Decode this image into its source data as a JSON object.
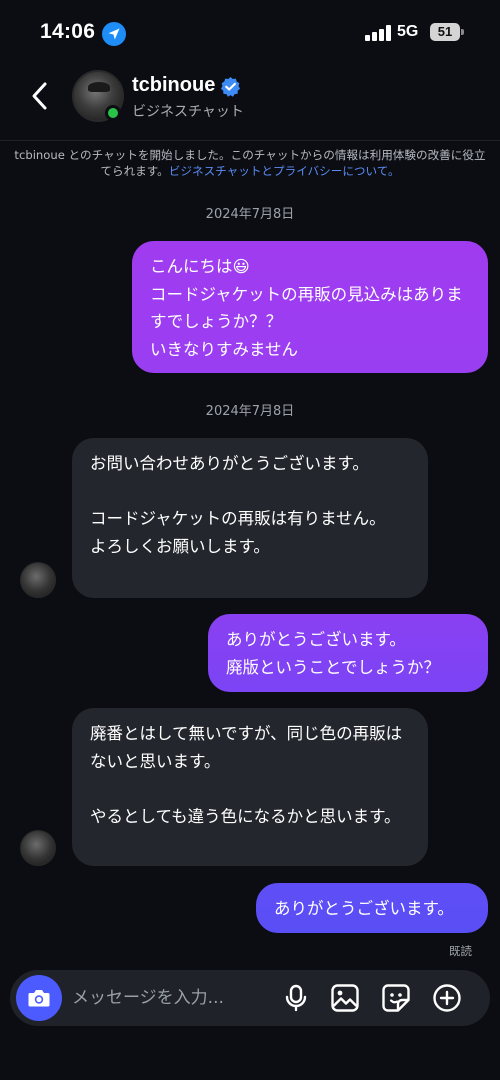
{
  "status_bar": {
    "time": "14:06",
    "network": "5G",
    "battery": "51",
    "location_icon": "location-arrow-icon",
    "signal_icon": "cellular-signal-icon"
  },
  "header": {
    "back_icon": "chevron-left-icon",
    "contact_name": "tcbinoue",
    "contact_subtitle": "ビジネスチャット",
    "verified_icon": "verified-badge-icon",
    "online": true
  },
  "notice": {
    "text": "tcbinoue とのチャットを開始しました。このチャットからの情報は利用体験の改善に役立てられます。",
    "link": "ビジネスチャットとプライバシーについて。"
  },
  "messages": [
    {
      "type": "date",
      "text": "2024年7月8日"
    },
    {
      "type": "outgoing",
      "text": "こんにちは😃\nコードジャケットの再販の見込みはありますでしょうか？？\nいきなりすみません"
    },
    {
      "type": "date",
      "text": "2024年7月8日"
    },
    {
      "type": "incoming",
      "text": "お問い合わせありがとうございます。\n\nコードジャケットの再販は有りません。\nよろしくお願いします。"
    },
    {
      "type": "outgoing",
      "text": "ありがとうございます。\n廃版ということでしょうか？"
    },
    {
      "type": "incoming",
      "text": "廃番とはして無いですが、同じ色の再販はないと思います。\n\nやるとしても違う色になるかと思います。"
    },
    {
      "type": "outgoing",
      "text": "ありがとうございます。"
    }
  ],
  "read_receipt": "既読",
  "composer": {
    "placeholder": "メッセージを入力...",
    "camera_icon": "camera-icon",
    "mic_icon": "microphone-icon",
    "gallery_icon": "image-icon",
    "sticker_icon": "sticker-icon",
    "add_icon": "plus-circle-icon"
  },
  "colors": {
    "background": "#0b0d12",
    "incoming_bubble": "#23262d",
    "outgoing_gradient_top": "#a03bf0",
    "outgoing_gradient_bottom": "#5b4ef5",
    "link": "#5b8df5",
    "online": "#29c34a",
    "camera_button": "#4b5bff"
  }
}
